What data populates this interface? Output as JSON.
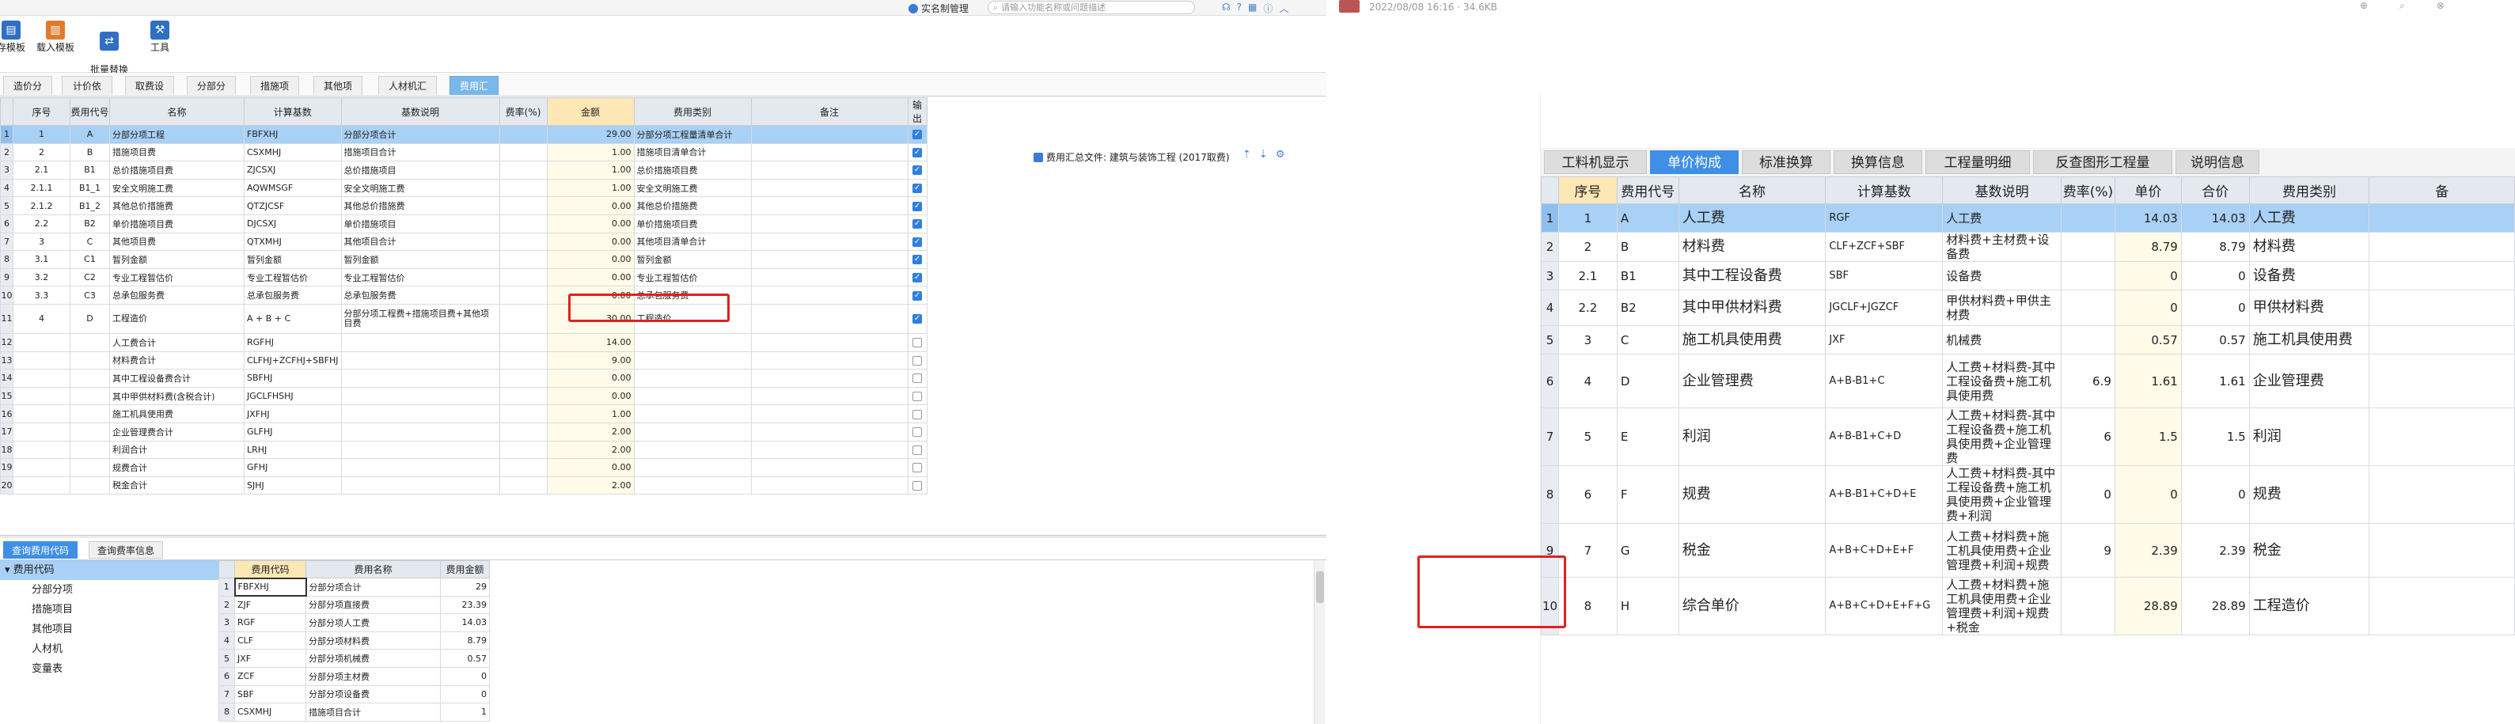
{
  "app": {
    "realname_label": "实名制管理",
    "search_placeholder": "请输入功能名称或问题描述",
    "top_icons": [
      "headset-icon",
      "help-icon",
      "grid-icon",
      "info-icon",
      "chevron-up-icon"
    ]
  },
  "toolbar": {
    "buttons": [
      {
        "label": "存模板",
        "icon": "save-template-icon"
      },
      {
        "label": "载入模板",
        "icon": "load-template-icon"
      },
      {
        "label": "批量替换\n费用表",
        "icon": "batch-replace-icon"
      },
      {
        "label": "工具",
        "icon": "tools-icon"
      }
    ]
  },
  "tabs": [
    {
      "label": "造价分析"
    },
    {
      "label": "计价依据"
    },
    {
      "label": "取费设置"
    },
    {
      "label": "分部分项"
    },
    {
      "label": "措施项目"
    },
    {
      "label": "其他项目"
    },
    {
      "label": "人材机汇总"
    },
    {
      "label": "费用汇总"
    }
  ],
  "summary_file": "费用汇总文件: 建筑与装饰工程 (2017取费)",
  "fee_table": {
    "headers": [
      "序号",
      "费用代号",
      "名称",
      "计算基数",
      "基数说明",
      "费率(%)",
      "金额",
      "费用类别",
      "备注",
      "输出"
    ],
    "rows": [
      {
        "no": "1",
        "code": "A",
        "name": "分部分项工程",
        "base": "FBFXHJ",
        "desc": "分部分项合计",
        "rate": "",
        "amount": "29.00",
        "category": "分部分项工程量清单合计",
        "note": "",
        "out": true
      },
      {
        "no": "2",
        "code": "B",
        "name": "措施项目费",
        "base": "CSXMHJ",
        "desc": "措施项目合计",
        "rate": "",
        "amount": "1.00",
        "category": "措施项目清单合计",
        "note": "",
        "out": true
      },
      {
        "no": "2.1",
        "code": "B1",
        "name": "总价措施项目费",
        "base": "ZJCSXJ",
        "desc": "总价措施项目",
        "rate": "",
        "amount": "1.00",
        "category": "总价措施项目费",
        "note": "",
        "out": true
      },
      {
        "no": "2.1.1",
        "code": "B1_1",
        "name": "安全文明施工费",
        "base": "AQWMSGF",
        "desc": "安全文明施工费",
        "rate": "",
        "amount": "1.00",
        "category": "安全文明施工费",
        "note": "",
        "out": true
      },
      {
        "no": "2.1.2",
        "code": "B1_2",
        "name": "其他总价措施费",
        "base": "QTZJCSF",
        "desc": "其他总价措施费",
        "rate": "",
        "amount": "0.00",
        "category": "其他总价措施费",
        "note": "",
        "out": true
      },
      {
        "no": "2.2",
        "code": "B2",
        "name": "单价措施项目费",
        "base": "DJCSXJ",
        "desc": "单价措施项目",
        "rate": "",
        "amount": "0.00",
        "category": "单价措施项目费",
        "note": "",
        "out": true
      },
      {
        "no": "3",
        "code": "C",
        "name": "其他项目费",
        "base": "QTXMHJ",
        "desc": "其他项目合计",
        "rate": "",
        "amount": "0.00",
        "category": "其他项目清单合计",
        "note": "",
        "out": true
      },
      {
        "no": "3.1",
        "code": "C1",
        "name": "暂列金额",
        "base": "暂列金额",
        "desc": "暂列金额",
        "rate": "",
        "amount": "0.00",
        "category": "暂列金额",
        "note": "",
        "out": true
      },
      {
        "no": "3.2",
        "code": "C2",
        "name": "专业工程暂估价",
        "base": "专业工程暂估价",
        "desc": "专业工程暂估价",
        "rate": "",
        "amount": "0.00",
        "category": "专业工程暂估价",
        "note": "",
        "out": true
      },
      {
        "no": "3.3",
        "code": "C3",
        "name": "总承包服务费",
        "base": "总承包服务费",
        "desc": "总承包服务费",
        "rate": "",
        "amount": "0.00",
        "category": "总承包服务费",
        "note": "",
        "out": true
      },
      {
        "no": "4",
        "code": "D",
        "name": "工程造价",
        "base": "A + B + C",
        "desc": "分部分项工程费+措施项目费+其他项目费",
        "rate": "",
        "amount": "30.00",
        "category": "工程造价",
        "note": "",
        "out": true
      },
      {
        "no": "",
        "code": "",
        "name": "人工费合计",
        "base": "RGFHJ",
        "desc": "",
        "rate": "",
        "amount": "14.00",
        "category": "",
        "note": "",
        "out": false
      },
      {
        "no": "",
        "code": "",
        "name": "材料费合计",
        "base": "CLFHJ+ZCFHJ+SBFHJ",
        "desc": "",
        "rate": "",
        "amount": "9.00",
        "category": "",
        "note": "",
        "out": false
      },
      {
        "no": "",
        "code": "",
        "name": "其中工程设备费合计",
        "base": "SBFHJ",
        "desc": "",
        "rate": "",
        "amount": "0.00",
        "category": "",
        "note": "",
        "out": false
      },
      {
        "no": "",
        "code": "",
        "name": "其中甲供材料费(含税合计)",
        "base": "JGCLFHSHJ",
        "desc": "",
        "rate": "",
        "amount": "0.00",
        "category": "",
        "note": "",
        "out": false
      },
      {
        "no": "",
        "code": "",
        "name": "施工机具使用费",
        "base": "JXFHJ",
        "desc": "",
        "rate": "",
        "amount": "1.00",
        "category": "",
        "note": "",
        "out": false
      },
      {
        "no": "",
        "code": "",
        "name": "企业管理费合计",
        "base": "GLFHJ",
        "desc": "",
        "rate": "",
        "amount": "2.00",
        "category": "",
        "note": "",
        "out": false
      },
      {
        "no": "",
        "code": "",
        "name": "利润合计",
        "base": "LRHJ",
        "desc": "",
        "rate": "",
        "amount": "2.00",
        "category": "",
        "note": "",
        "out": false
      },
      {
        "no": "",
        "code": "",
        "name": "规费合计",
        "base": "GFHJ",
        "desc": "",
        "rate": "",
        "amount": "0.00",
        "category": "",
        "note": "",
        "out": false
      },
      {
        "no": "",
        "code": "",
        "name": "税金合计",
        "base": "SJHJ",
        "desc": "",
        "rate": "",
        "amount": "2.00",
        "category": "",
        "note": "",
        "out": false
      }
    ]
  },
  "bottom_tabs": [
    "查询费用代码",
    "查询费率信息"
  ],
  "tree": {
    "root": "费用代码",
    "children": [
      "分部分项",
      "措施项目",
      "其他项目",
      "人材机",
      "变量表"
    ]
  },
  "code_table": {
    "headers": [
      "费用代码",
      "费用名称",
      "费用金额"
    ],
    "rows": [
      {
        "code": "FBFXHJ",
        "name": "分部分项合计",
        "amount": "29"
      },
      {
        "code": "ZJF",
        "name": "分部分项直接费",
        "amount": "23.39"
      },
      {
        "code": "RGF",
        "name": "分部分项人工费",
        "amount": "14.03"
      },
      {
        "code": "CLF",
        "name": "分部分项材料费",
        "amount": "8.79"
      },
      {
        "code": "JXF",
        "name": "分部分项机械费",
        "amount": "0.57"
      },
      {
        "code": "ZCF",
        "name": "分部分项主材费",
        "amount": "0"
      },
      {
        "code": "SBF",
        "name": "分部分项设备费",
        "amount": "0"
      },
      {
        "code": "CSXMHJ",
        "name": "措施项目合计",
        "amount": "1"
      }
    ]
  },
  "right": {
    "meta": "2022/08/08 16:16 · 34.6KB",
    "tabs": [
      "工料机显示",
      "单价构成",
      "标准换算",
      "换算信息",
      "工程量明细",
      "反查图形工程量",
      "说明信息"
    ],
    "headers": [
      "序号",
      "费用代号",
      "名称",
      "计算基数",
      "基数说明",
      "费率(%)",
      "单价",
      "合价",
      "费用类别",
      "备"
    ],
    "rows": [
      {
        "no": "1",
        "code": "A",
        "name": "人工费",
        "base": "RGF",
        "desc": "人工费",
        "rate": "",
        "price": "14.03",
        "total": "14.03",
        "category": "人工费"
      },
      {
        "no": "2",
        "code": "B",
        "name": "材料费",
        "base": "CLF+ZCF+SBF",
        "desc": "材料费+主材费+设备费",
        "rate": "",
        "price": "8.79",
        "total": "8.79",
        "category": "材料费"
      },
      {
        "no": "2.1",
        "code": "B1",
        "name": "其中工程设备费",
        "base": "SBF",
        "desc": "设备费",
        "rate": "",
        "price": "0",
        "total": "0",
        "category": "设备费"
      },
      {
        "no": "2.2",
        "code": "B2",
        "name": "其中甲供材料费",
        "base": "JGCLF+JGZCF",
        "desc": "甲供材料费+甲供主材费",
        "rate": "",
        "price": "0",
        "total": "0",
        "category": "甲供材料费"
      },
      {
        "no": "3",
        "code": "C",
        "name": "施工机具使用费",
        "base": "JXF",
        "desc": "机械费",
        "rate": "",
        "price": "0.57",
        "total": "0.57",
        "category": "施工机具使用费"
      },
      {
        "no": "4",
        "code": "D",
        "name": "企业管理费",
        "base": "A+B-B1+C",
        "desc": "人工费+材料费-其中工程设备费+施工机具使用费",
        "rate": "6.9",
        "price": "1.61",
        "total": "1.61",
        "category": "企业管理费"
      },
      {
        "no": "5",
        "code": "E",
        "name": "利润",
        "base": "A+B-B1+C+D",
        "desc": "人工费+材料费-其中工程设备费+施工机具使用费+企业管理费",
        "rate": "6",
        "price": "1.5",
        "total": "1.5",
        "category": "利润"
      },
      {
        "no": "6",
        "code": "F",
        "name": "规费",
        "base": "A+B-B1+C+D+E",
        "desc": "人工费+材料费-其中工程设备费+施工机具使用费+企业管理费+利润",
        "rate": "0",
        "price": "0",
        "total": "0",
        "category": "规费"
      },
      {
        "no": "7",
        "code": "G",
        "name": "税金",
        "base": "A+B+C+D+E+F",
        "desc": "人工费+材料费+施工机具使用费+企业管理费+利润+规费",
        "rate": "9",
        "price": "2.39",
        "total": "2.39",
        "category": "税金"
      },
      {
        "no": "8",
        "code": "H",
        "name": "综合单价",
        "base": "A+B+C+D+E+F+G",
        "desc": "人工费+材料费+施工机具使用费+企业管理费+利润+规费+税金",
        "rate": "",
        "price": "28.89",
        "total": "28.89",
        "category": "工程造价"
      }
    ]
  }
}
